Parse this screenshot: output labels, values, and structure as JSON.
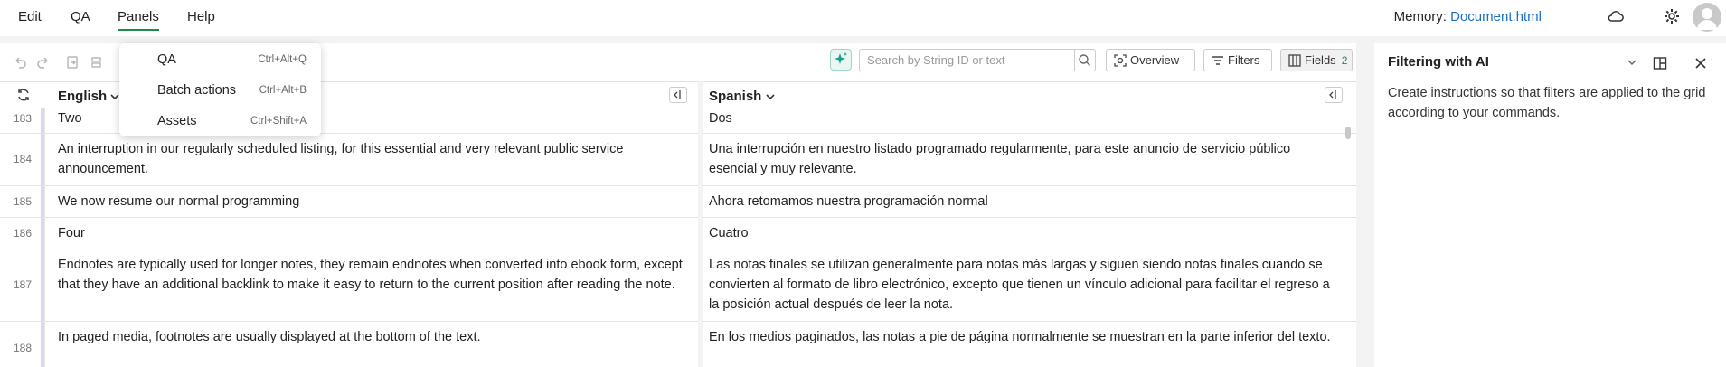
{
  "menubar": {
    "items": [
      "Edit",
      "QA",
      "Panels",
      "Help"
    ],
    "memory_label": "Memory:",
    "memory_file": "Document.html"
  },
  "toolbar": {
    "search_placeholder": "Search by String ID or text",
    "overview_label": "Overview",
    "filters_label": "Filters",
    "fields_label": "Fields",
    "fields_count": "2"
  },
  "panels_menu": {
    "items": [
      {
        "label": "QA",
        "shortcut": "Ctrl+Alt+Q"
      },
      {
        "label": "Batch actions",
        "shortcut": "Ctrl+Alt+B"
      },
      {
        "label": "Assets",
        "shortcut": "Ctrl+Shift+A"
      }
    ]
  },
  "grid": {
    "columns": [
      "English",
      "Spanish"
    ],
    "rows": [
      {
        "num": "183",
        "en": "Two",
        "es": "Dos"
      },
      {
        "num": "184",
        "en": "An interruption in our regularly scheduled listing, for this essential and very relevant public service announcement.",
        "es": "Una interrupción en nuestro listado programado regularmente, para este anuncio de servicio público esencial y muy relevante."
      },
      {
        "num": "185",
        "en": "We now resume our normal programming",
        "es": "Ahora retomamos nuestra programación normal"
      },
      {
        "num": "186",
        "en": "Four",
        "es": "Cuatro"
      },
      {
        "num": "187",
        "en": "Endnotes are typically used for longer notes, they remain endnotes when converted into ebook form, except that they have an additional backlink to make it easy to return to the current position after reading the note.",
        "es": "Las notas finales se utilizan generalmente para notas más largas y siguen siendo notas finales cuando se convierten al formato de libro electrónico, excepto que tienen un vínculo adicional para facilitar el regreso a la posición actual después de leer la nota."
      },
      {
        "num": "188",
        "en": "In paged media, footnotes are usually displayed at the bottom of the text.",
        "es": "En los medios paginados, las notas a pie de página normalmente se muestran en la parte inferior del texto."
      }
    ]
  },
  "side_panel": {
    "title": "Filtering with AI",
    "description": "Create instructions so that filters are applied to the grid according to your commands."
  },
  "colors": {
    "accent": "#1e8a4c",
    "link": "#1a6fc4",
    "row_marker": "#d5d9f1"
  }
}
